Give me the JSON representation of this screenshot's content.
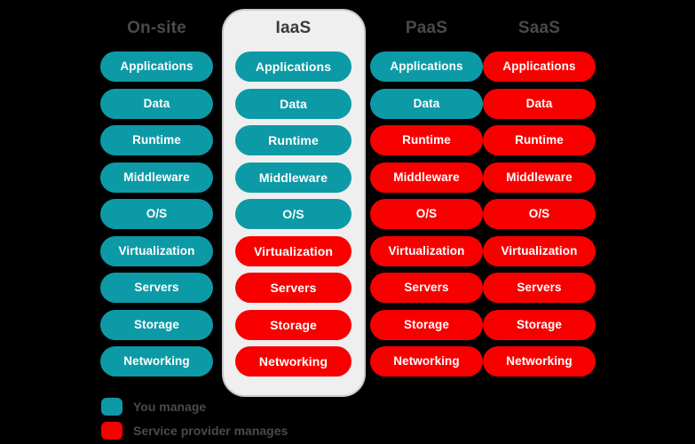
{
  "diagram": {
    "title": "Cloud service models responsibility matrix",
    "background_color": "#000000",
    "colors": {
      "you_manage": "#0d9aa7",
      "provider_manages": "#f90000",
      "panel_background": "#efefef",
      "panel_border": "#c9c9c9",
      "header_text": "#4a4a4a"
    }
  },
  "columns": [
    {
      "id": "on-site",
      "header": "On-site",
      "highlighted": false,
      "layers": [
        {
          "label": "Applications",
          "owner": "you-manage"
        },
        {
          "label": "Data",
          "owner": "you-manage"
        },
        {
          "label": "Runtime",
          "owner": "you-manage"
        },
        {
          "label": "Middleware",
          "owner": "you-manage"
        },
        {
          "label": "O/S",
          "owner": "you-manage"
        },
        {
          "label": "Virtualization",
          "owner": "you-manage"
        },
        {
          "label": "Servers",
          "owner": "you-manage"
        },
        {
          "label": "Storage",
          "owner": "you-manage"
        },
        {
          "label": "Networking",
          "owner": "you-manage"
        }
      ]
    },
    {
      "id": "iaas",
      "header": "IaaS",
      "highlighted": true,
      "layers": [
        {
          "label": "Applications",
          "owner": "you-manage"
        },
        {
          "label": "Data",
          "owner": "you-manage"
        },
        {
          "label": "Runtime",
          "owner": "you-manage"
        },
        {
          "label": "Middleware",
          "owner": "you-manage"
        },
        {
          "label": "O/S",
          "owner": "you-manage"
        },
        {
          "label": "Virtualization",
          "owner": "provider-manages"
        },
        {
          "label": "Servers",
          "owner": "provider-manages"
        },
        {
          "label": "Storage",
          "owner": "provider-manages"
        },
        {
          "label": "Networking",
          "owner": "provider-manages"
        }
      ]
    },
    {
      "id": "paas",
      "header": "PaaS",
      "highlighted": false,
      "layers": [
        {
          "label": "Applications",
          "owner": "you-manage"
        },
        {
          "label": "Data",
          "owner": "you-manage"
        },
        {
          "label": "Runtime",
          "owner": "provider-manages"
        },
        {
          "label": "Middleware",
          "owner": "provider-manages"
        },
        {
          "label": "O/S",
          "owner": "provider-manages"
        },
        {
          "label": "Virtualization",
          "owner": "provider-manages"
        },
        {
          "label": "Servers",
          "owner": "provider-manages"
        },
        {
          "label": "Storage",
          "owner": "provider-manages"
        },
        {
          "label": "Networking",
          "owner": "provider-manages"
        }
      ]
    },
    {
      "id": "saas",
      "header": "SaaS",
      "highlighted": false,
      "layers": [
        {
          "label": "Applications",
          "owner": "provider-manages"
        },
        {
          "label": "Data",
          "owner": "provider-manages"
        },
        {
          "label": "Runtime",
          "owner": "provider-manages"
        },
        {
          "label": "Middleware",
          "owner": "provider-manages"
        },
        {
          "label": "O/S",
          "owner": "provider-manages"
        },
        {
          "label": "Virtualization",
          "owner": "provider-manages"
        },
        {
          "label": "Servers",
          "owner": "provider-manages"
        },
        {
          "label": "Storage",
          "owner": "provider-manages"
        },
        {
          "label": "Networking",
          "owner": "provider-manages"
        }
      ]
    }
  ],
  "legend": {
    "items": [
      {
        "label": "You manage",
        "swatch": "teal",
        "color": "#0d9aa7"
      },
      {
        "label": "Service provider manages",
        "swatch": "red",
        "color": "#f90000"
      }
    ]
  }
}
